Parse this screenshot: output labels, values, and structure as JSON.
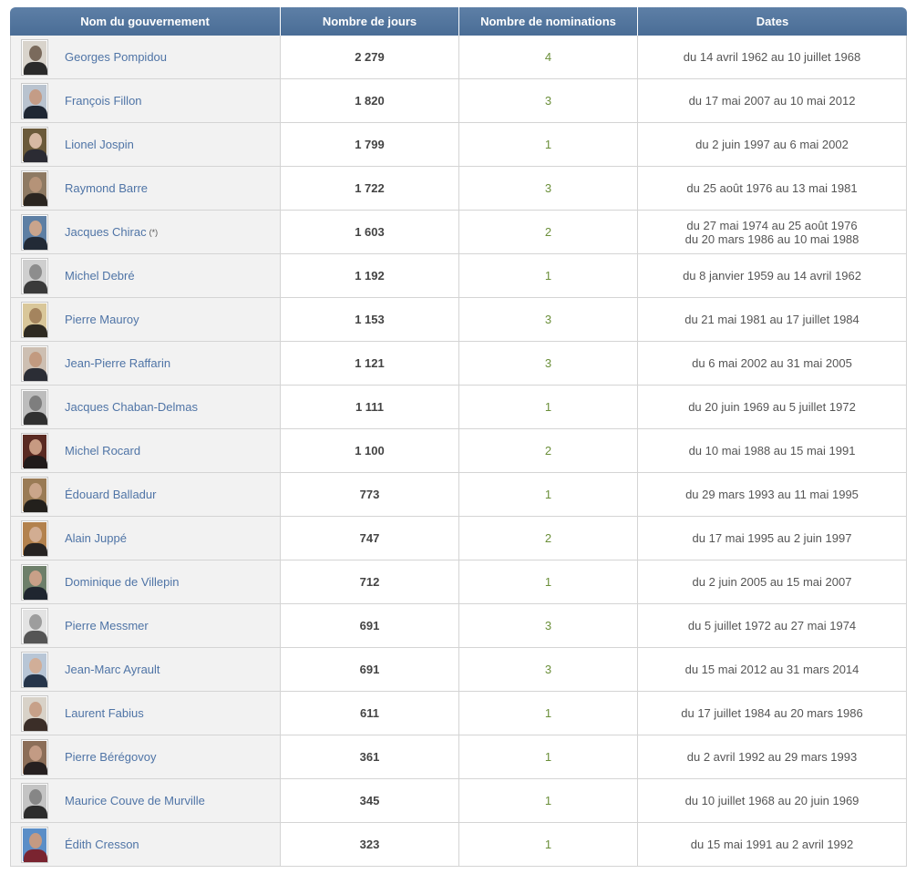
{
  "headers": {
    "name": "Nom du gouvernement",
    "days": "Nombre de jours",
    "nominations": "Nombre de nominations",
    "dates": "Dates"
  },
  "rows": [
    {
      "name": "Georges Pompidou",
      "note": "",
      "days": "2 279",
      "nominations": "4",
      "dates": [
        "du 14 avril 1962 au 10 juillet 1968"
      ],
      "photo": {
        "bg": "#d9d4cc",
        "skin": "#7a6a5c",
        "suit": "#2a2a2a"
      }
    },
    {
      "name": "François Fillon",
      "note": "",
      "days": "1 820",
      "nominations": "3",
      "dates": [
        "du 17 mai 2007 au 10 mai 2012"
      ],
      "photo": {
        "bg": "#b9c3cf",
        "skin": "#c49c86",
        "suit": "#1f2733"
      }
    },
    {
      "name": "Lionel Jospin",
      "note": "",
      "days": "1 799",
      "nominations": "1",
      "dates": [
        "du 2 juin 1997 au 6 mai 2002"
      ],
      "photo": {
        "bg": "#6b5a3a",
        "skin": "#d7b9a3",
        "suit": "#2b2b33"
      }
    },
    {
      "name": "Raymond Barre",
      "note": "",
      "days": "1 722",
      "nominations": "3",
      "dates": [
        "du 25 août 1976 au 13 mai 1981"
      ],
      "photo": {
        "bg": "#8e7a63",
        "skin": "#b59378",
        "suit": "#2a2520"
      }
    },
    {
      "name": "Jacques Chirac",
      "note": "(*)",
      "days": "1 603",
      "nominations": "2",
      "dates": [
        "du 27 mai 1974 au 25 août 1976",
        "du 20 mars 1986 au 10 mai 1988"
      ],
      "photo": {
        "bg": "#5d7fa4",
        "skin": "#c9a48c",
        "suit": "#222a36"
      }
    },
    {
      "name": "Michel Debré",
      "note": "",
      "days": "1 192",
      "nominations": "1",
      "dates": [
        "du 8 janvier 1959 au 14 avril 1962"
      ],
      "photo": {
        "bg": "#cfcfcf",
        "skin": "#8d8d8d",
        "suit": "#3a3a3a"
      }
    },
    {
      "name": "Pierre Mauroy",
      "note": "",
      "days": "1 153",
      "nominations": "3",
      "dates": [
        "du 21 mai 1981 au 17 juillet 1984"
      ],
      "photo": {
        "bg": "#d9c79a",
        "skin": "#a4845e",
        "suit": "#2e2a22"
      }
    },
    {
      "name": "Jean-Pierre Raffarin",
      "note": "",
      "days": "1 121",
      "nominations": "3",
      "dates": [
        "du 6 mai 2002 au 31 mai 2005"
      ],
      "photo": {
        "bg": "#cdbfb2",
        "skin": "#c29a80",
        "suit": "#2b2d35"
      }
    },
    {
      "name": "Jacques Chaban-Delmas",
      "note": "",
      "days": "1 111",
      "nominations": "1",
      "dates": [
        "du 20 juin 1969 au 5 juillet 1972"
      ],
      "photo": {
        "bg": "#bdbdbd",
        "skin": "#7e7e7e",
        "suit": "#303030"
      }
    },
    {
      "name": "Michel Rocard",
      "note": "",
      "days": "1 100",
      "nominations": "2",
      "dates": [
        "du 10 mai 1988 au 15 mai 1991"
      ],
      "photo": {
        "bg": "#5a2a22",
        "skin": "#c79a82",
        "suit": "#201a1a"
      }
    },
    {
      "name": "Édouard Balladur",
      "note": "",
      "days": "773",
      "nominations": "1",
      "dates": [
        "du 29 mars 1993 au 11 mai 1995"
      ],
      "photo": {
        "bg": "#9a7b55",
        "skin": "#caa58a",
        "suit": "#23201c"
      }
    },
    {
      "name": "Alain Juppé",
      "note": "",
      "days": "747",
      "nominations": "2",
      "dates": [
        "du 17 mai 1995 au 2 juin 1997"
      ],
      "photo": {
        "bg": "#b3824e",
        "skin": "#d2ad92",
        "suit": "#262322"
      }
    },
    {
      "name": "Dominique de Villepin",
      "note": "",
      "days": "712",
      "nominations": "1",
      "dates": [
        "du 2 juin 2005 au 15 mai 2007"
      ],
      "photo": {
        "bg": "#6d7f6a",
        "skin": "#c8a088",
        "suit": "#1f2630"
      }
    },
    {
      "name": "Pierre Messmer",
      "note": "",
      "days": "691",
      "nominations": "3",
      "dates": [
        "du 5 juillet 1972 au 27 mai 1974"
      ],
      "photo": {
        "bg": "#e3e3e3",
        "skin": "#9d9d9d",
        "suit": "#555555"
      }
    },
    {
      "name": "Jean-Marc Ayrault",
      "note": "",
      "days": "691",
      "nominations": "3",
      "dates": [
        "du 15 mai 2012 au 31 mars 2014"
      ],
      "photo": {
        "bg": "#b8c6d6",
        "skin": "#d1ae98",
        "suit": "#26354a"
      }
    },
    {
      "name": "Laurent Fabius",
      "note": "",
      "days": "611",
      "nominations": "1",
      "dates": [
        "du 17 juillet 1984 au 20 mars 1986"
      ],
      "photo": {
        "bg": "#d8d2c8",
        "skin": "#c7a189",
        "suit": "#3b2e28"
      }
    },
    {
      "name": "Pierre Bérégovoy",
      "note": "",
      "days": "361",
      "nominations": "1",
      "dates": [
        "du 2 avril 1992 au 29 mars 1993"
      ],
      "photo": {
        "bg": "#8c6e58",
        "skin": "#c39b84",
        "suit": "#262020"
      }
    },
    {
      "name": "Maurice Couve de Murville",
      "note": "",
      "days": "345",
      "nominations": "1",
      "dates": [
        "du 10 juillet 1968 au 20 juin 1969"
      ],
      "photo": {
        "bg": "#c4c4c4",
        "skin": "#868686",
        "suit": "#2c2c2c"
      }
    },
    {
      "name": "Édith Cresson",
      "note": "",
      "days": "323",
      "nominations": "1",
      "dates": [
        "du 15 mai 1991 au 2 avril 1992"
      ],
      "photo": {
        "bg": "#5b8ec7",
        "skin": "#c49a82",
        "suit": "#7a2430"
      }
    }
  ]
}
